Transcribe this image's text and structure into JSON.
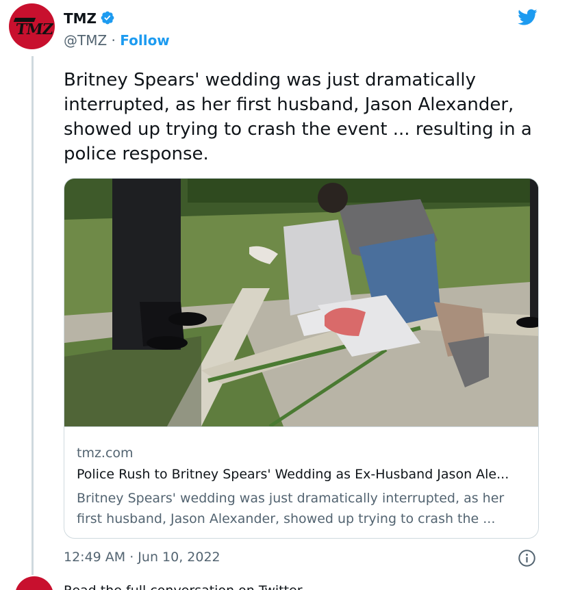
{
  "author": {
    "name": "TMZ",
    "handle": "@TMZ",
    "separator": "·",
    "follow_label": "Follow",
    "avatar_text": "TMZ"
  },
  "tweet": {
    "text": "Britney Spears' wedding was just dramatically interrupted, as her first husband, Jason Alexander, showed up trying to crash the event ... resulting in a police response.",
    "timestamp": "12:49 AM · Jun 10, 2022"
  },
  "link_card": {
    "domain": "tmz.com",
    "title": "Police Rush to Britney Spears' Wedding as Ex-Husband Jason Ale...",
    "description": "Britney Spears' wedding was just dramatically interrupted, as her first husband, Jason Alexander, showed up trying to crash the ..."
  },
  "next_item": {
    "text": "Read the full conversation on Twitter"
  },
  "icons": {
    "brand": "twitter-bird-icon",
    "verified": "verified-badge-icon",
    "info": "info-icon"
  },
  "colors": {
    "accent": "#1d9bf0",
    "text_primary": "#0f1419",
    "text_secondary": "#536471",
    "border": "#cfd9de",
    "brand_red": "#c8102e"
  }
}
